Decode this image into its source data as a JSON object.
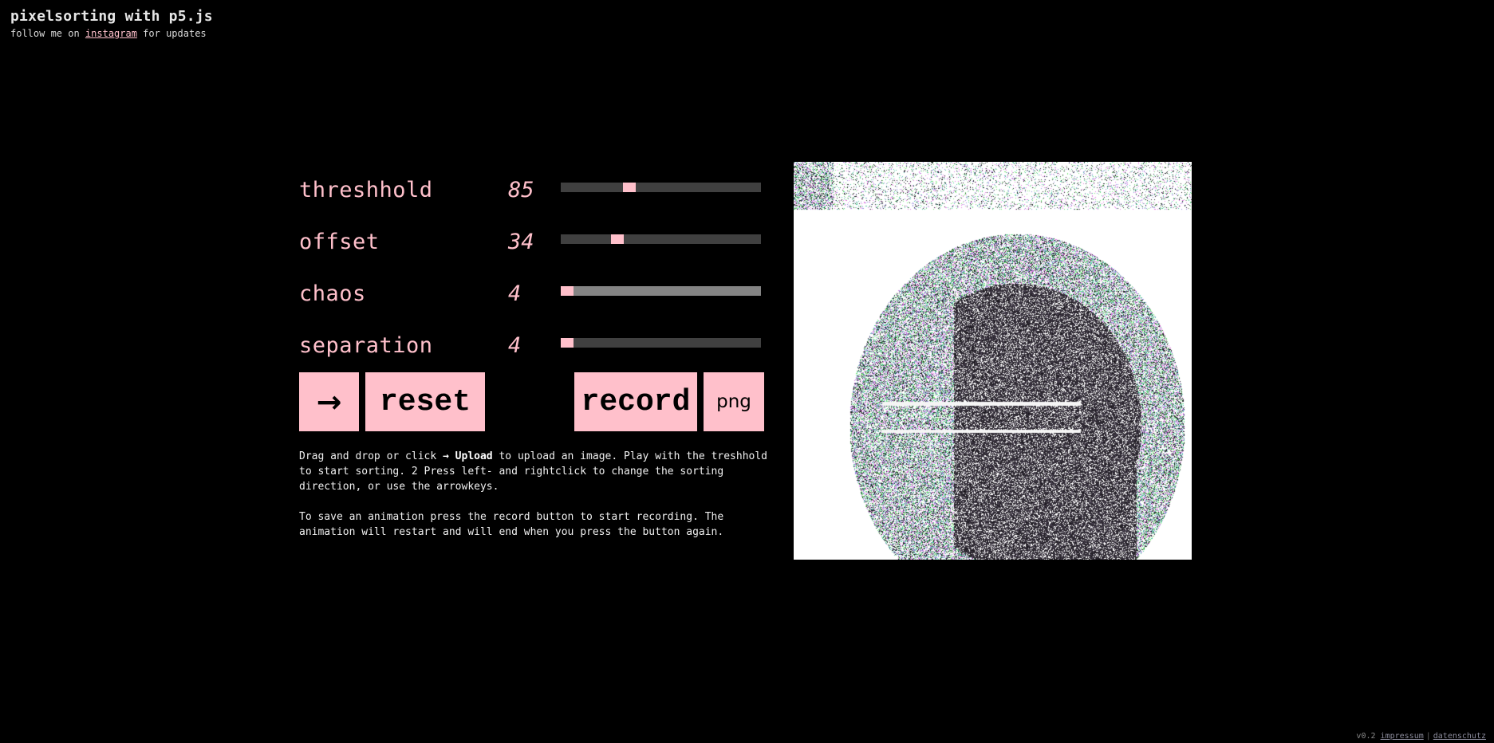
{
  "header": {
    "title": "pixelsorting with p5.js",
    "subtitle_prefix": "follow me on ",
    "subtitle_link": "instagram",
    "subtitle_suffix": " for updates"
  },
  "controls": [
    {
      "label": "threshhold",
      "value": "85",
      "fraction": 0.333,
      "hover": false
    },
    {
      "label": "offset",
      "value": "34",
      "fraction": 0.27,
      "hover": false
    },
    {
      "label": "chaos",
      "value": "4",
      "fraction": 0.0,
      "hover": true
    },
    {
      "label": "separation",
      "value": "4",
      "fraction": 0.0,
      "hover": false
    }
  ],
  "buttons": {
    "upload_icon": "→",
    "reset": "reset",
    "record": "record",
    "png": "png"
  },
  "help": {
    "p1_a": "Drag and drop or click ",
    "p1_b": "→ Upload",
    "p1_c": " to upload an image. Play with the treshhold to start sorting. 2 Press left- and rightclick to change the sorting direction, or use the arrowkeys.",
    "p2": "To save an animation press the record button to start recording. The animation will restart and will end when you press the button again."
  },
  "canvas": {
    "description": "pixel-sorted portrait"
  },
  "footer": {
    "version": "v0.2",
    "impressum": "impressum",
    "datenschutz": "datenschutz"
  },
  "colors": {
    "accent": "#ffc0cb",
    "track": "#404040",
    "track_hover": "#848484",
    "background": "#000000"
  }
}
